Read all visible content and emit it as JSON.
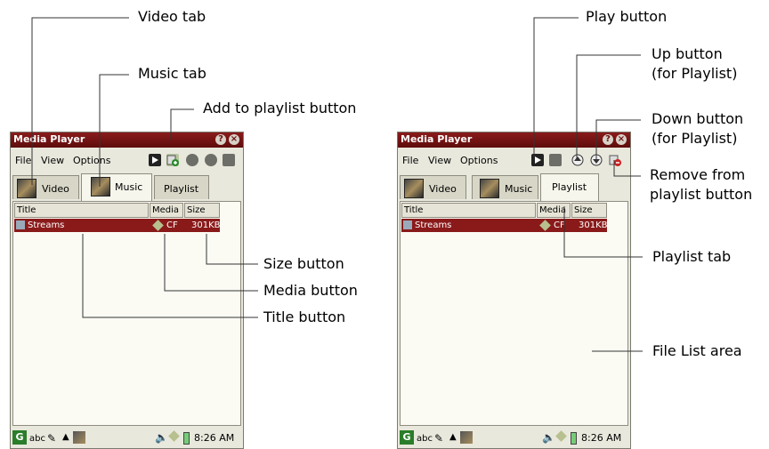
{
  "left_device": {
    "window_title": "Media Player",
    "menu": [
      "File",
      "View",
      "Options"
    ],
    "tabs": [
      "Video",
      "Music",
      "Playlist"
    ],
    "columns": [
      "Title",
      "Media",
      "Size"
    ],
    "row": {
      "title": "Streams",
      "media": "CF",
      "size": "301KB"
    },
    "clock": "8:26 AM",
    "taskbar_text": "abc"
  },
  "right_device": {
    "window_title": "Media Player",
    "menu": [
      "File",
      "View",
      "Options"
    ],
    "tabs": [
      "Video",
      "Music",
      "Playlist"
    ],
    "columns": [
      "Title",
      "Media",
      "Size"
    ],
    "row": {
      "title": "Streams",
      "media": "CF",
      "size": "301KB"
    },
    "clock": "8:26 AM",
    "taskbar_text": "abc"
  },
  "callouts": {
    "video_tab": "Video tab",
    "music_tab": "Music tab",
    "add_to_playlist": "Add to playlist button",
    "size_button": "Size button",
    "media_button": "Media button",
    "title_button": "Title button",
    "play_button": "Play button",
    "up_button_1": "Up button",
    "up_button_2": "(for Playlist)",
    "down_button_1": "Down button",
    "down_button_2": "(for Playlist)",
    "remove_1": "Remove from",
    "remove_2": "playlist button",
    "playlist_tab": "Playlist tab",
    "file_list_area": "File List area"
  },
  "colors": {
    "titlebar": "#6e1313",
    "selected_row": "#8a1a1a",
    "window_bg": "#e9e8dd",
    "list_bg": "#fbfbf4"
  }
}
